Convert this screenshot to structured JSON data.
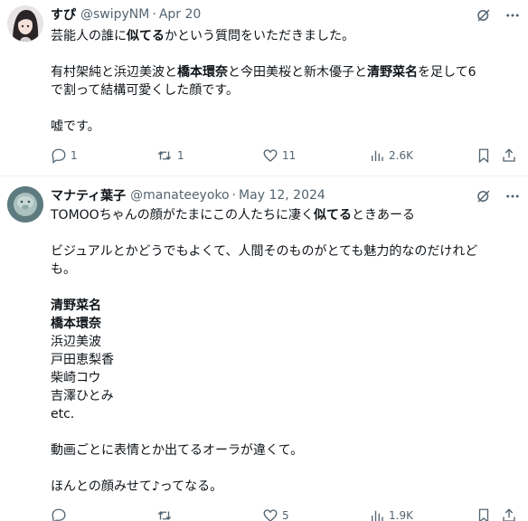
{
  "tweets": [
    {
      "name": "すぴ",
      "handle": "@swipyNM",
      "date": "Apr 20",
      "lines": [
        [
          {
            "t": "芸能人の誰に"
          },
          {
            "t": "似てる",
            "b": true
          },
          {
            "t": "かという質問をいただきました。"
          }
        ],
        [],
        [
          {
            "t": "有村架純と浜辺美波と"
          },
          {
            "t": "橋本環奈",
            "b": true
          },
          {
            "t": "と今田美桜と新木優子と"
          },
          {
            "t": "清野菜名",
            "b": true
          },
          {
            "t": "を足して6"
          }
        ],
        [
          {
            "t": "で割って結構可愛くした顔です。"
          }
        ],
        [],
        [
          {
            "t": "嘘です。"
          }
        ]
      ],
      "stats": {
        "replies": "1",
        "reposts": "1",
        "likes": "11",
        "views": "2.6K"
      }
    },
    {
      "name": "マナティ葉子",
      "handle": "@manateeyoko",
      "date": "May 12, 2024",
      "lines": [
        [
          {
            "t": "TOMOOちゃんの顔がたまにこの人たちに凄く"
          },
          {
            "t": "似てる",
            "b": true
          },
          {
            "t": "ときあーる"
          }
        ],
        [],
        [
          {
            "t": "ビジュアルとかどうでもよくて、人間そのものがとても魅力的なのだけれど"
          }
        ],
        [
          {
            "t": "も。"
          }
        ],
        [],
        [
          {
            "t": "清野菜名",
            "b": true
          }
        ],
        [
          {
            "t": "橋本環奈",
            "b": true
          }
        ],
        [
          {
            "t": "浜辺美波"
          }
        ],
        [
          {
            "t": "戸田恵梨香"
          }
        ],
        [
          {
            "t": "柴崎コウ"
          }
        ],
        [
          {
            "t": "吉澤ひとみ"
          }
        ],
        [
          {
            "t": "etc."
          }
        ],
        [],
        [
          {
            "t": "動画ごとに表情とか出てるオーラが違くて。"
          }
        ],
        [],
        [
          {
            "t": "ほんとの顔みせて♪ってなる。"
          }
        ]
      ],
      "stats": {
        "replies": "",
        "reposts": "",
        "likes": "5",
        "views": "1.9K"
      }
    }
  ],
  "icons": {
    "grok": "grok-icon",
    "more": "more-icon",
    "reply": "reply-icon",
    "repost": "repost-icon",
    "like": "like-icon",
    "views": "views-icon",
    "bookmark": "bookmark-icon",
    "share": "share-icon"
  },
  "colors": {
    "text": "#0f1419",
    "secondary": "#536471",
    "divider": "#eff3f4"
  }
}
